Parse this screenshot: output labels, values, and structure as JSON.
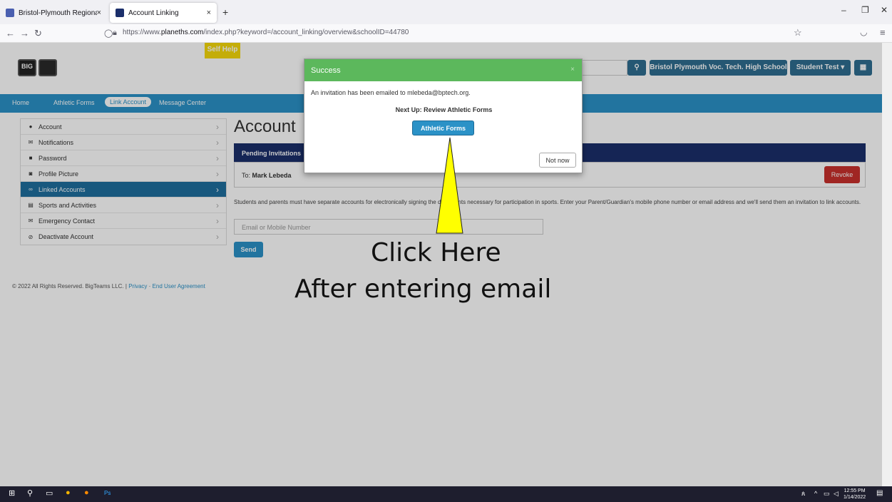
{
  "browser": {
    "tabs": [
      {
        "title": "Bristol-Plymouth Regional Voca",
        "close": "×"
      },
      {
        "title": "Account Linking",
        "close": "×"
      }
    ],
    "new_tab": "+",
    "url_prefix": "https://www.",
    "url_domain": "planeths.com",
    "url_rest": "/index.php?keyword=/account_linking/overview&schoolID=44780"
  },
  "header": {
    "logo_text": "BIG",
    "self_help": "Self Help",
    "school_button": "Bristol Plymouth Voc. Tech. High School",
    "user_button": "Student Test ▾"
  },
  "topnav": [
    "Home",
    "Athletic Forms",
    "Link Account",
    "Message Center"
  ],
  "sidebar": {
    "items": [
      {
        "label": "Account",
        "icon": "user-icon"
      },
      {
        "label": "Notifications",
        "icon": "envelope-icon"
      },
      {
        "label": "Password",
        "icon": "lock-icon"
      },
      {
        "label": "Profile Picture",
        "icon": "camera-icon"
      },
      {
        "label": "Linked Accounts",
        "icon": "link-icon"
      },
      {
        "label": "Sports and Activities",
        "icon": "list-icon"
      },
      {
        "label": "Emergency Contact",
        "icon": "envelope-icon"
      },
      {
        "label": "Deactivate Account",
        "icon": "ban-icon"
      }
    ]
  },
  "main": {
    "title": "Account",
    "pending_header": "Pending Invitations",
    "pending_to": "To:",
    "pending_name": "Mark Lebeda",
    "revoke": "Revoke",
    "description": "Students and parents must have separate accounts for electronically signing the documents necessary for participation in sports. Enter your Parent/Guardian's mobile phone number or email address and we'll send them an invitation to link accounts.",
    "email_placeholder": "Email or Mobile Number",
    "send": "Send"
  },
  "footer": {
    "copyright": "© 2022 All Rights Reserved. BigTeams LLC.",
    "sep1": "|",
    "privacy": "Privacy",
    "sep2": "·",
    "eula": "End User Agreement"
  },
  "modal": {
    "title": "Success",
    "close": "×",
    "message": "An invitation has been emailed to mlebeda@bptech.org.",
    "next_up": "Next Up: Review Athletic Forms",
    "athletic_forms": "Athletic Forms",
    "not_now": "Not now"
  },
  "annotation": {
    "line1": "Click Here",
    "line2": "After entering email",
    "arrow_color": "#ffff00"
  },
  "taskbar": {
    "time": "12:55 PM",
    "date": "1/14/2022"
  }
}
